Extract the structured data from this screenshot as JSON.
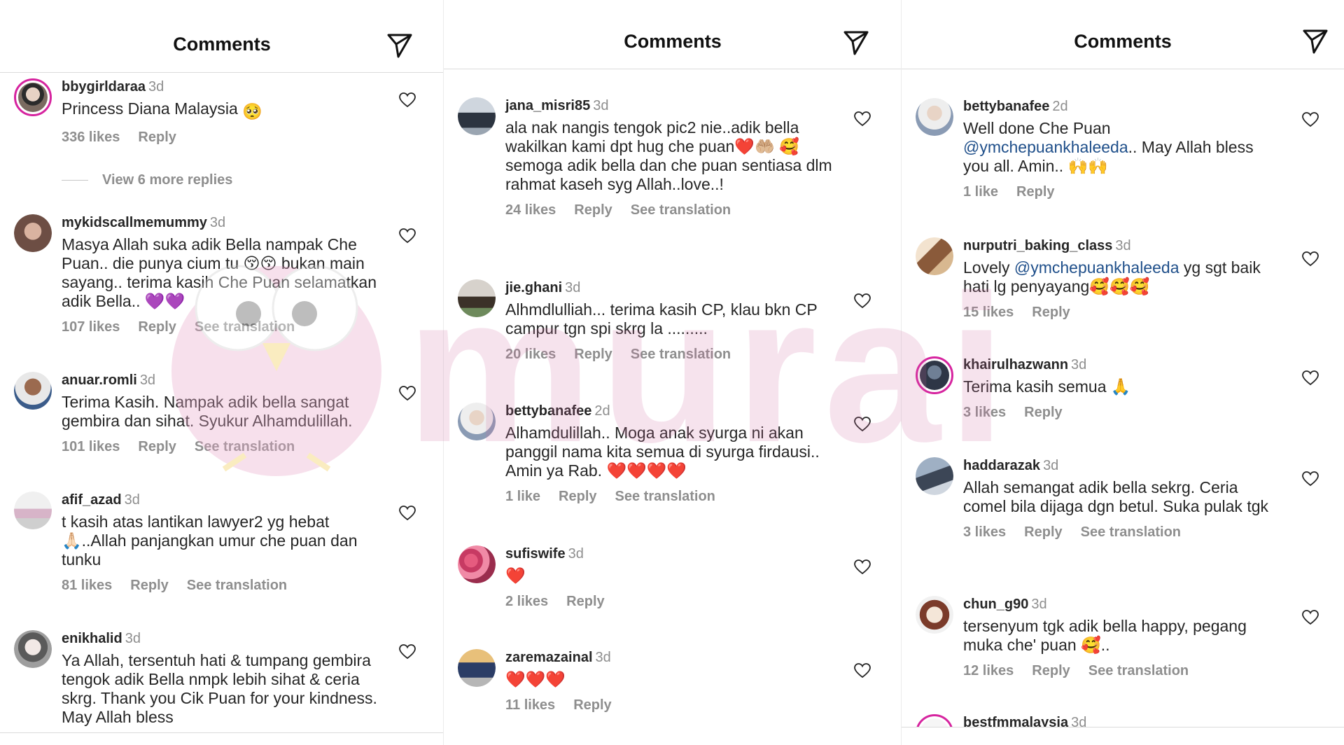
{
  "panels": [
    {
      "title": "Comments",
      "view_more": "View 6 more replies",
      "comments": [
        {
          "user": "bbygirldaraa",
          "time": "3d",
          "text": "Princess Diana Malaysia",
          "emoji": "🥺",
          "likes": "336 likes",
          "reply": "Reply",
          "translation": ""
        },
        {
          "user": "mykidscallmemummy",
          "time": "3d",
          "text": "Masya Allah suka adik Bella nampak Che Puan.. die punya cium tu 😚😚 bukan main sayang.. terima kasih Che Puan selamatkan adik Bella.. 💜💜",
          "emoji": "",
          "likes": "107 likes",
          "reply": "Reply",
          "translation": "See translation"
        },
        {
          "user": "anuar.romli",
          "time": "3d",
          "text": "Terima Kasih. Nampak adik bella sangat gembira dan sihat. Syukur Alhamdulillah.",
          "emoji": "",
          "likes": "101 likes",
          "reply": "Reply",
          "translation": "See translation"
        },
        {
          "user": "afif_azad",
          "time": "3d",
          "text": "t kasih atas lantikan lawyer2 yg hebat 🙏🏻..Allah panjangkan umur che puan dan tunku",
          "emoji": "",
          "likes": "81 likes",
          "reply": "Reply",
          "translation": "See translation"
        },
        {
          "user": "enikhalid",
          "time": "3d",
          "text": "Ya Allah, tersentuh hati & tumpang gembira tengok adik Bella nmpk lebih sihat & ceria skrg. Thank you Cik Puan for your kindness. May Allah bless",
          "emoji": "",
          "likes": "",
          "reply": "",
          "translation": ""
        }
      ]
    },
    {
      "title": "Comments",
      "comments": [
        {
          "user": "jana_misri85",
          "time": "3d",
          "text": "ala nak nangis tengok pic2 nie..adik bella wakilkan kami dpt hug che puan❤️🤲🏼 🥰 semoga adik bella dan che puan sentiasa dlm rahmat kaseh syg Allah..love..!",
          "emoji": "",
          "likes": "24 likes",
          "reply": "Reply",
          "translation": "See translation"
        },
        {
          "user": "jie.ghani",
          "time": "3d",
          "text": "Alhmdlulliah... terima kasih CP, klau bkn CP campur tgn spi skrg la .........",
          "emoji": "",
          "likes": "20 likes",
          "reply": "Reply",
          "translation": "See translation"
        },
        {
          "user": "bettybanafee",
          "time": "2d",
          "text": "Alhamdulillah.. Moga anak syurga ni akan panggil nama kita semua di syurga firdausi.. Amin ya Rab. ❤️❤️❤️❤️",
          "emoji": "",
          "likes": "1 like",
          "reply": "Reply",
          "translation": "See translation"
        },
        {
          "user": "sufiswife",
          "time": "3d",
          "text": "❤️",
          "emoji": "",
          "likes": "2 likes",
          "reply": "Reply",
          "translation": ""
        },
        {
          "user": "zaremazainal",
          "time": "3d",
          "text": "❤️❤️❤️",
          "emoji": "",
          "likes": "11 likes",
          "reply": "Reply",
          "translation": ""
        }
      ]
    },
    {
      "title": "Comments",
      "comments": [
        {
          "user": "bettybanafee",
          "time": "2d",
          "text_before": "Well done Che Puan ",
          "mention": "@ymchepuankhaleeda",
          "text_after": ".. May Allah bless you all. Amin.. 🙌🙌",
          "likes": "1 like",
          "reply": "Reply",
          "translation": ""
        },
        {
          "user": "nurputri_baking_class",
          "time": "3d",
          "text_before": "Lovely ",
          "mention": "@ymchepuankhaleeda",
          "text_after": " yg sgt baik hati lg penyayang🥰🥰🥰",
          "likes": "15 likes",
          "reply": "Reply",
          "translation": ""
        },
        {
          "user": "khairulhazwann",
          "time": "3d",
          "text_before": "Terima kasih semua 🙏",
          "mention": "",
          "text_after": "",
          "likes": "3 likes",
          "reply": "Reply",
          "translation": ""
        },
        {
          "user": "haddarazak",
          "time": "3d",
          "text_before": "Allah semangat adik bella sekrg. Ceria comel bila dijaga dgn betul. Suka pulak tgk",
          "mention": "",
          "text_after": "",
          "likes": "3 likes",
          "reply": "Reply",
          "translation": "See translation"
        },
        {
          "user": "chun_g90",
          "time": "3d",
          "text_before": "tersenyum tgk adik bella happy, pegang muka che' puan 🥰..",
          "mention": "",
          "text_after": "",
          "likes": "12 likes",
          "reply": "Reply",
          "translation": "See translation"
        },
        {
          "user": "bestfmmalaysia",
          "time": "3d",
          "text_before": "",
          "mention": "",
          "text_after": "",
          "likes": "",
          "reply": "",
          "translation": ""
        }
      ]
    }
  ],
  "watermark_text": "murai",
  "colors": {
    "text": "#262626",
    "muted": "#8e8e8e",
    "mention": "#1f4f8a",
    "ring": "#d6249f"
  }
}
